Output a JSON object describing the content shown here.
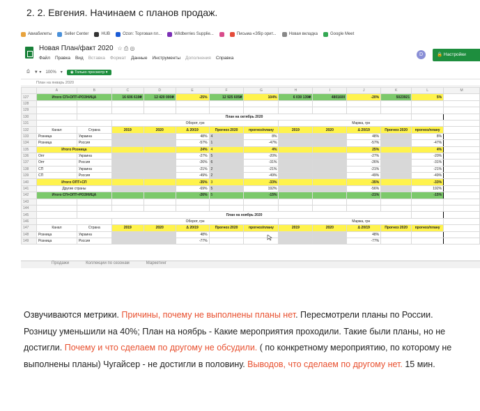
{
  "heading": "2. 2. Евгения. Начинаем с планов продаж.",
  "bookmarks": [
    {
      "label": "Авиабилеты",
      "color": "#e8a33d"
    },
    {
      "label": "Seller Center",
      "color": "#4a90d9"
    },
    {
      "label": "HUB",
      "color": "#333333"
    },
    {
      "label": "Ozon: Торговая пл...",
      "color": "#1a5bd6"
    },
    {
      "label": "Wildberries Supplie...",
      "color": "#7b2fb5"
    },
    {
      "label": "",
      "color": "#d94c8b"
    },
    {
      "label": "Письма «Збір орит...",
      "color": "#e44b3a"
    },
    {
      "label": "Новая вкладка",
      "color": "#888888"
    },
    {
      "label": "Google Meet",
      "color": "#34a853"
    }
  ],
  "doc": {
    "title": "Новая План/факт 2020",
    "title_icons": "☆ ⎙ ◎",
    "menus": [
      "Файл",
      "Правка",
      "Вид",
      "Вставка",
      "Формат",
      "Данные",
      "Инструменты",
      "Дополнения",
      "Справка"
    ],
    "avatar": "D",
    "settings_button": "Настройки"
  },
  "toolbar": {
    "items": [
      "⎙",
      "▼ ▾",
      "100%",
      "▾"
    ],
    "view_only": "◉ Только просмотр ▾"
  },
  "formula_bar": "План на январь 2020",
  "sheet": {
    "columns": [
      "A",
      "B",
      "C",
      "D",
      "E",
      "F",
      "G",
      "H",
      "I",
      "J",
      "K",
      "L",
      "M"
    ],
    "row127": {
      "num": "127",
      "label": "Итого СП+ОПТ+РОЗНИЦА",
      "c": "16 606 619₴",
      "d": "12 420 000₴",
      "e": "-25%",
      "f": "12 925 605₴",
      "g": "104%",
      "h": "6 030 139₴",
      "i": "4801600",
      "j": "-20%",
      "k": "5023921",
      "l": "5%"
    },
    "blank_rows": [
      "128",
      "129"
    ],
    "oct_title_num": "130",
    "oct_title": "План на октябрь 2020",
    "oct_group_num": "131",
    "oborot": "Оборот, грн",
    "marzha": "Маржа, грн",
    "hdr_num": "132",
    "hdr": {
      "kanal": "Канал",
      "strana": "Страна",
      "y2019": "2019",
      "y2020": "2020",
      "delta": "Δ 20/19",
      "prognoz": "Прогноз 2020",
      "prognoz_plan": "прогноз/плану"
    },
    "oct_rows": [
      {
        "num": "133",
        "kanal": "Розница",
        "strana": "Украина",
        "e": "48%",
        "f": "4",
        "g": "8%",
        "j": "48%",
        "l": "8%",
        "style": ""
      },
      {
        "num": "134",
        "kanal": "Розница",
        "strana": "Россия",
        "e": "-57%",
        "f": "1",
        "g": "-47%",
        "j": "-57%",
        "l": "-47%",
        "style": ""
      },
      {
        "num": "135",
        "kanal": "Итого Розница",
        "strana": "",
        "e": "24%",
        "f": "4",
        "g": "4%",
        "j": "25%",
        "l": "4%",
        "style": "yellow"
      },
      {
        "num": "136",
        "kanal": "Опт",
        "strana": "Украина",
        "e": "-27%",
        "f": "5",
        "g": "-20%",
        "j": "-27%",
        "l": "-20%",
        "style": ""
      },
      {
        "num": "137",
        "kanal": "Опт",
        "strana": "Россия",
        "e": "-26%",
        "f": "6",
        "g": "-31%",
        "j": "-26%",
        "l": "-31%",
        "style": ""
      },
      {
        "num": "138",
        "kanal": "СП",
        "strana": "Украина",
        "e": "-21%",
        "f": "2",
        "g": "-21%",
        "j": "-21%",
        "l": "-21%",
        "style": ""
      },
      {
        "num": "139",
        "kanal": "СП",
        "strana": "Россия",
        "e": "-49%",
        "f": "2",
        "g": "-49%",
        "j": "-49%",
        "l": "-49%",
        "style": ""
      },
      {
        "num": "140",
        "kanal": "Итого ОПТ+СП",
        "strana": "",
        "e": "-35%",
        "f": "3",
        "g": "-33%",
        "j": "-35%",
        "l": "-33%",
        "style": "yellow"
      },
      {
        "num": "141",
        "kanal": "Другие страны",
        "strana": "",
        "e": "-69%",
        "f": "5",
        "g": "192%",
        "j": "-56%",
        "l": "192%",
        "style": ""
      },
      {
        "num": "142",
        "kanal": "Итого СП+ОПТ+РОЗНИЦА",
        "strana": "",
        "e": "-26%",
        "f": "5",
        "g": "-15%",
        "j": "-21%",
        "l": "-15%",
        "style": "green"
      }
    ],
    "blank_rows2": [
      "143",
      "144"
    ],
    "nov_title_num": "145",
    "nov_title": "План на ноябрь 2020",
    "nov_group_num": "146",
    "nov_hdr_num": "147",
    "nov_rows": [
      {
        "num": "148",
        "kanal": "Розница",
        "strana": "Украина",
        "e": "48%",
        "j": "48%"
      },
      {
        "num": "149",
        "kanal": "Розница",
        "strana": "Россия",
        "e": "-77%",
        "j": "-77%"
      }
    ],
    "tabs": [
      "Продажи",
      "Коллекции по сезонам",
      "Маркетинг"
    ]
  },
  "paragraph": [
    {
      "text": "Озвучиваются метрики.  ",
      "color": "#222222"
    },
    {
      "text": "Причины, почему не выполнены планы нет",
      "color": "#e8502f"
    },
    {
      "text": ". Пересмотрели планы по России. Розницу уменьшили на 40%; План на ноябрь - Какие мероприятия проходили. Такие были планы, но не достигли. ",
      "color": "#222222"
    },
    {
      "text": "Почему и что сделаем по другому не обсудили.",
      "color": "#e8502f"
    },
    {
      "text": "  ( по конкретному мероприятию, по которому не выполнены планы) Чугайсер - не достигли в половину. ",
      "color": "#222222"
    },
    {
      "text": "Выводов, что сделаем по другому нет.",
      "color": "#e8502f"
    },
    {
      "text": " 15 мин.",
      "color": "#222222"
    }
  ]
}
